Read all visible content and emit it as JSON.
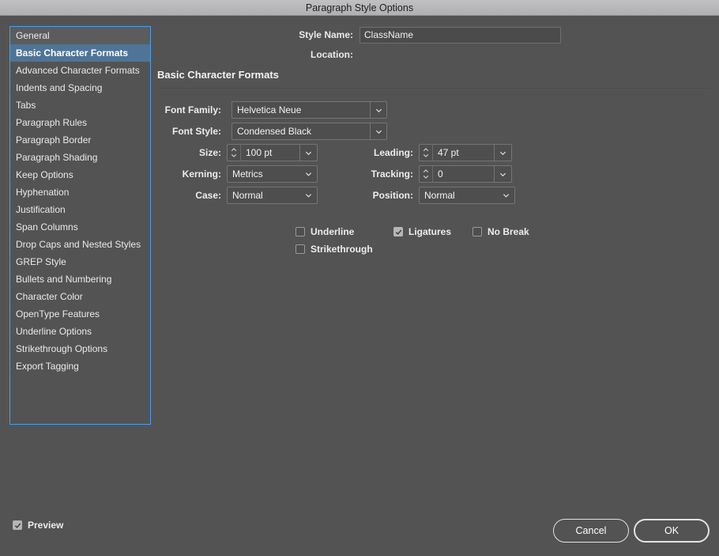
{
  "window": {
    "title": "Paragraph Style Options"
  },
  "sidebar": {
    "items": [
      {
        "label": "General",
        "state": "first"
      },
      {
        "label": "Basic Character Formats",
        "state": "selected"
      },
      {
        "label": "Advanced Character Formats",
        "state": "normal"
      },
      {
        "label": "Indents and Spacing",
        "state": "normal"
      },
      {
        "label": "Tabs",
        "state": "normal"
      },
      {
        "label": "Paragraph Rules",
        "state": "normal"
      },
      {
        "label": "Paragraph Border",
        "state": "normal"
      },
      {
        "label": "Paragraph Shading",
        "state": "normal"
      },
      {
        "label": "Keep Options",
        "state": "normal"
      },
      {
        "label": "Hyphenation",
        "state": "normal"
      },
      {
        "label": "Justification",
        "state": "normal"
      },
      {
        "label": "Span Columns",
        "state": "normal"
      },
      {
        "label": "Drop Caps and Nested Styles",
        "state": "normal"
      },
      {
        "label": "GREP Style",
        "state": "normal"
      },
      {
        "label": "Bullets and Numbering",
        "state": "normal"
      },
      {
        "label": "Character Color",
        "state": "normal"
      },
      {
        "label": "OpenType Features",
        "state": "normal"
      },
      {
        "label": "Underline Options",
        "state": "normal"
      },
      {
        "label": "Strikethrough Options",
        "state": "normal"
      },
      {
        "label": "Export Tagging",
        "state": "normal"
      }
    ]
  },
  "header": {
    "style_name_label": "Style Name:",
    "style_name_value": "ClassName",
    "style_name_placeholder": "",
    "location_label": "Location:",
    "location_value": ""
  },
  "section": {
    "title": "Basic Character Formats"
  },
  "fields": {
    "font_family_label": "Font Family:",
    "font_family_value": "Helvetica Neue",
    "font_style_label": "Font Style:",
    "font_style_value": "Condensed Black",
    "size_label": "Size:",
    "size_value": "100 pt",
    "leading_label": "Leading:",
    "leading_value": "47 pt",
    "kerning_label": "Kerning:",
    "kerning_value": "Metrics",
    "tracking_label": "Tracking:",
    "tracking_value": "0",
    "case_label": "Case:",
    "case_value": "Normal",
    "position_label": "Position:",
    "position_value": "Normal"
  },
  "checkboxes": {
    "underline": {
      "label": "Underline",
      "checked": false
    },
    "ligatures": {
      "label": "Ligatures",
      "checked": true
    },
    "no_break": {
      "label": "No Break",
      "checked": false
    },
    "strikethrough": {
      "label": "Strikethrough",
      "checked": false
    }
  },
  "footer": {
    "preview_label": "Preview",
    "preview_checked": true,
    "cancel_label": "Cancel",
    "ok_label": "OK"
  },
  "colors": {
    "dialog_bg": "#535353",
    "titlebar_bg": "#b4b4b6",
    "selection_blue": "#4f7496",
    "focus_border_blue": "#4a9eed",
    "field_bg": "#4e4e4e",
    "text": "#ececec"
  }
}
